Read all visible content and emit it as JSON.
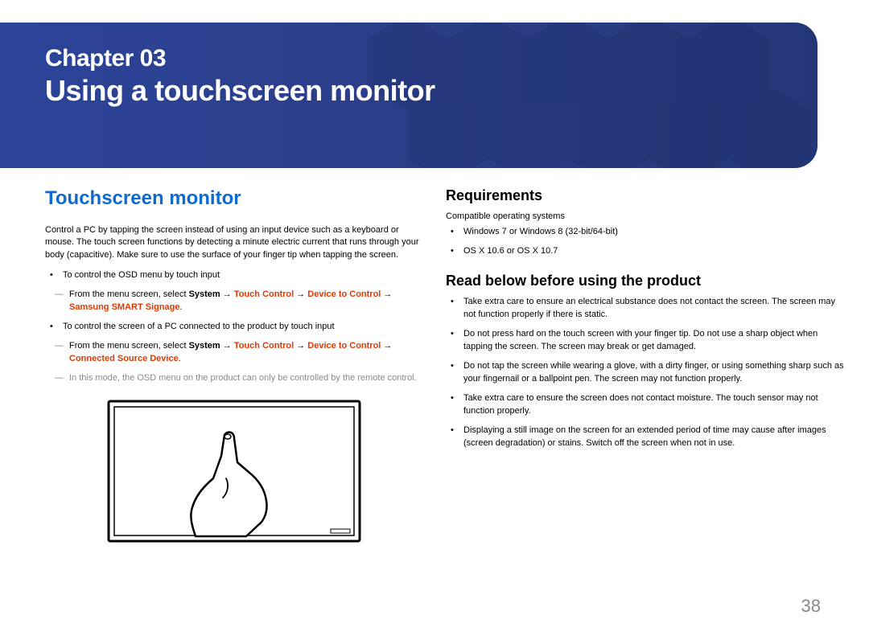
{
  "banner": {
    "chapter_label": "Chapter  03",
    "chapter_title": "Using a touchscreen monitor"
  },
  "left": {
    "heading": "Touchscreen monitor",
    "intro": "Control a PC by tapping the screen instead of using an input device such as a keyboard or mouse. The touch screen functions by detecting a minute electric current that runs through your body (capacitive). Make sure to use the surface of your finger tip when tapping the screen.",
    "b1": "To control the OSD menu by touch input",
    "b1_note_prefix": "From the menu screen, select ",
    "b1_note_bold1": "System",
    "b1_note_arrow": " → ",
    "b1_note_bold2": "Touch Control",
    "b1_note_bold3": "Device to Control",
    "b1_note_bold4": "Samsung SMART Signage",
    "b1_note_period": ".",
    "b2": "To control the screen of a PC connected to the product by touch input",
    "b2_note_prefix": "From the menu screen, select ",
    "b2_note_bold1": "System",
    "b2_note_bold2": "Touch Control",
    "b2_note_bold3": "Device to Control",
    "b2_note_bold4": "Connected Source Device",
    "b3_grey": "In this mode, the OSD menu on the product can only be controlled by the remote control."
  },
  "right": {
    "req_heading": "Requirements",
    "req_sub": "Compatible operating systems",
    "req_b1": "Windows 7 or Windows 8 (32-bit/64-bit)",
    "req_b2": "OS X 10.6 or OS X 10.7",
    "read_heading": "Read below before using the product",
    "rb1": "Take extra care to ensure an electrical substance does not contact the screen. The screen may not function properly if there is static.",
    "rb2": "Do not press hard on the touch screen with your finger tip. Do not use a sharp object when tapping the screen. The screen may break or get damaged.",
    "rb3": "Do not tap the screen while wearing a glove, with a dirty finger, or using something sharp such as your fingernail or a ballpoint pen. The screen may not function properly.",
    "rb4": "Take extra care to ensure the screen does not contact moisture. The touch sensor may not function properly.",
    "rb5": "Displaying a still image on the screen for an extended period of time may cause after images (screen degradation) or stains. Switch off the screen when not in use."
  },
  "page_number": "38"
}
